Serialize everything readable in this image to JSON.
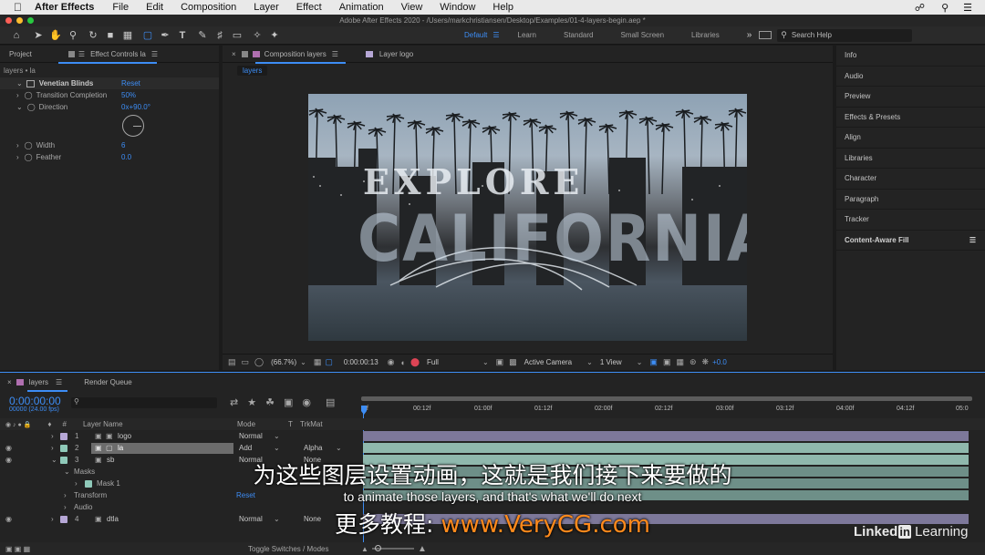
{
  "menubar": {
    "app": "After Effects",
    "items": [
      "File",
      "Edit",
      "Composition",
      "Layer",
      "Effect",
      "Animation",
      "View",
      "Window",
      "Help"
    ]
  },
  "window_title": "Adobe After Effects 2020 - /Users/markchristiansen/Desktop/Examples/01-4-layers-begin.aep *",
  "workspaces": {
    "items": [
      "Default",
      "Learn",
      "Standard",
      "Small Screen",
      "Libraries"
    ],
    "search_placeholder": "Search Help"
  },
  "project_panel": {
    "tab_project": "Project",
    "tab_effect_controls": "Effect Controls la",
    "breadcrumb": "layers • la",
    "effect_name": "Venetian Blinds",
    "reset": "Reset",
    "params": [
      {
        "name": "Transition Completion",
        "value": "50%"
      },
      {
        "name": "Direction",
        "value": "0x+90.0°"
      },
      {
        "name": "Width",
        "value": "6"
      },
      {
        "name": "Feather",
        "value": "0.0"
      }
    ]
  },
  "comp_panel": {
    "tab_comp": "Composition layers",
    "tab_layer": "Layer logo",
    "comp_chip": "layers",
    "title_line1": "EXPLORE",
    "title_line2": "CALIFORNIA",
    "zoom": "(66.7%)",
    "timecode": "0:00:00:13",
    "resolution": "Full",
    "camera": "Active Camera",
    "view": "1 View",
    "exposure": "+0.0"
  },
  "right_panel": {
    "items": [
      "Info",
      "Audio",
      "Preview",
      "Effects & Presets",
      "Align",
      "Libraries",
      "Character",
      "Paragraph",
      "Tracker",
      "Content-Aware Fill"
    ]
  },
  "timeline": {
    "tab_layers": "layers",
    "tab_render": "Render Queue",
    "timecode": "0:00:00:00",
    "frame_info": "00000 (24.00 fps)",
    "col_layer_name": "Layer Name",
    "col_mode": "Mode",
    "col_t": "T",
    "col_trkmat": "TrkMat",
    "ruler": [
      "0f",
      "00:12f",
      "01:00f",
      "01:12f",
      "02:00f",
      "02:12f",
      "03:00f",
      "03:12f",
      "04:00f",
      "04:12f",
      "05:0"
    ],
    "layers": [
      {
        "num": "1",
        "name": "logo",
        "mode": "Normal",
        "trkmat": ""
      },
      {
        "num": "2",
        "name": "la",
        "mode": "Add",
        "trkmat": "Alpha"
      },
      {
        "num": "3",
        "name": "sb",
        "mode": "Normal",
        "trkmat": "None"
      },
      {
        "num": "4",
        "name": "dtla",
        "mode": "Normal",
        "trkmat": "None"
      }
    ],
    "sub_masks": "Masks",
    "sub_mask1": "Mask 1",
    "sub_transform": "Transform",
    "sub_transform_reset": "Reset",
    "sub_audio": "Audio",
    "toggle": "Toggle Switches / Modes"
  },
  "subtitles": {
    "chinese": "为这些图层设置动画，这就是我们接下来要做的",
    "english": "to animate those layers, and that's what we'll do next",
    "promo_label": "更多教程:",
    "promo_url": "www.VeryCG.com"
  },
  "watermark": {
    "brand_a": "Linked",
    "brand_b": "in",
    "brand_c": " Learning"
  }
}
